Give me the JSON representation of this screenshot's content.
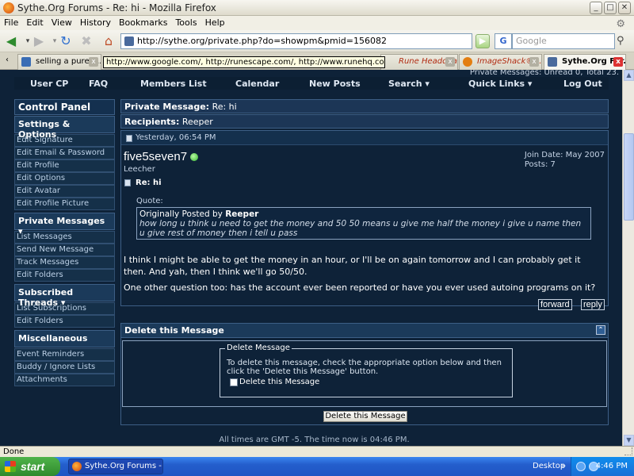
{
  "window": {
    "title": "Sythe.Org Forums - Re: hi - Mozilla Firefox",
    "minimize": "_",
    "maximize": "□",
    "close": "✕"
  },
  "menu": [
    "File",
    "Edit",
    "View",
    "History",
    "Bookmarks",
    "Tools",
    "Help"
  ],
  "navbar": {
    "url": "http://sythe.org/private.php?do=showpm&pmid=156082",
    "search_engine": "G",
    "search_placeholder": "Google",
    "icons": [
      "back-icon",
      "forward-icon",
      "reload-icon",
      "stop-icon",
      "home-icon"
    ]
  },
  "tabs": [
    {
      "label": "selling a pure fi...",
      "icon_color": "#3a6db5",
      "active": false
    },
    {
      "label": "Rune Headquar...",
      "icon_color": "#222222",
      "active": false
    },
    {
      "label": "ImageShack® -...",
      "icon_color": "#e37e12",
      "active": false
    },
    {
      "label": "Sythe.Org For...",
      "icon_color": "#4a6a9c",
      "active": true
    }
  ],
  "tooltip": "http://www.google.com/, http://runescape.com/, http://www.runehq.com/RHQItemVi...",
  "tab_more": "»",
  "page": {
    "pm_count": "Private Messages: Unread 0, Total 23.",
    "nav": [
      "User CP",
      "FAQ",
      "Members List",
      "Calendar",
      "New Posts",
      "Search ▾",
      "Quick Links ▾",
      "Log Out"
    ],
    "sidebar": {
      "control_panel": "Control Panel",
      "settings_head": "Settings & Options",
      "settings_items": [
        "Edit Signature",
        "Edit Email & Password",
        "Edit Profile",
        "Edit Options",
        "Edit Avatar",
        "Edit Profile Picture"
      ],
      "pm_head": "Private Messages ▾",
      "pm_items": [
        "List Messages",
        "Send New Message",
        "Track Messages",
        "Edit Folders"
      ],
      "threads_head": "Subscribed Threads ▾",
      "threads_items": [
        "List Subscriptions",
        "Edit Folders"
      ],
      "misc_head": "Miscellaneous",
      "misc_items": [
        "Event Reminders",
        "Buddy / Ignore Lists",
        "Attachments"
      ]
    },
    "pm": {
      "header_label": "Private Message:",
      "header_value": "Re: hi",
      "recipients_label": "Recipients:",
      "recipients_value": "Reeper",
      "date": "Yesterday, 06:54 PM",
      "author": "five5seven7",
      "rank": "Leecher",
      "join_date": "Join Date: May 2007",
      "posts": "Posts: 7",
      "subject": "Re: hi",
      "quote_label": "Quote:",
      "quote_intro": "Originally Posted by",
      "quote_author": "Reeper",
      "quote_text": "how long u think u need to get the money and 50 50 means u give me half the money i give u name then u give rest of money then i tell u pass",
      "body1": "I think I might be able to get the money in an hour, or I'll be on again tomorrow and I can probably get it then. And yah, then I think we'll go 50/50.",
      "body2": "One other question too: has the account ever been reported or have you ever used autoing programs on it?",
      "forward": "forward",
      "reply": "reply"
    },
    "delete": {
      "head": "Delete this Message",
      "legend": "Delete Message",
      "desc": "To delete this message, check the appropriate option below and then click the 'Delete this Message' button.",
      "checkbox_label": "Delete this Message",
      "button": "Delete this Message"
    },
    "timezone": "All times are GMT -5. The time now is 04:46 PM."
  },
  "status": "Done",
  "taskbar": {
    "start": "start",
    "task": "Sythe.Org Forums - ...",
    "desktop": "Desktop",
    "desktop_arrow": "»",
    "clock": "4:46 PM"
  }
}
